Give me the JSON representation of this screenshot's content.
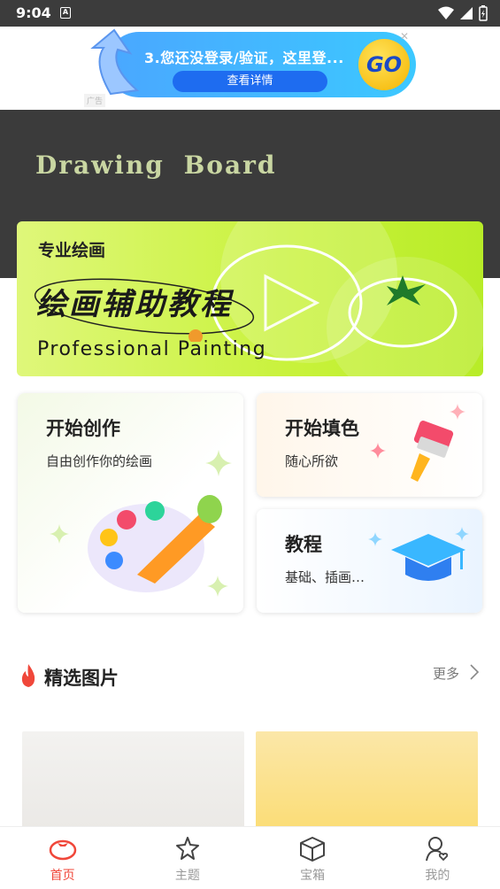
{
  "status_bar": {
    "time": "9:04",
    "notification_icon": "A"
  },
  "ad": {
    "text": "3.您还没登录/验证，这里登...",
    "button_label": "查看详情",
    "go_label": "GO",
    "tag": "广告"
  },
  "hero": {
    "title": "Drawing  Board"
  },
  "banner": {
    "subtitle": "专业绘画",
    "title": "绘画辅助教程",
    "english": "Professional Painting"
  },
  "cards": {
    "create": {
      "title": "开始创作",
      "desc": "自由创作你的绘画"
    },
    "fill": {
      "title": "开始填色",
      "desc": "随心所欲"
    },
    "tutorial": {
      "title": "教程",
      "desc": "基础、插画…"
    }
  },
  "section": {
    "title": "精选图片",
    "more": "更多"
  },
  "nav": [
    {
      "label": "首页",
      "icon": "tomato-icon",
      "active": true
    },
    {
      "label": "主题",
      "icon": "star-icon",
      "active": false
    },
    {
      "label": "宝箱",
      "icon": "box-icon",
      "active": false
    },
    {
      "label": "我的",
      "icon": "user-icon",
      "active": false
    }
  ],
  "colors": {
    "accent": "#f0473a",
    "banner_green": "#c8f23a",
    "hero_dark": "#3b3b3b"
  }
}
